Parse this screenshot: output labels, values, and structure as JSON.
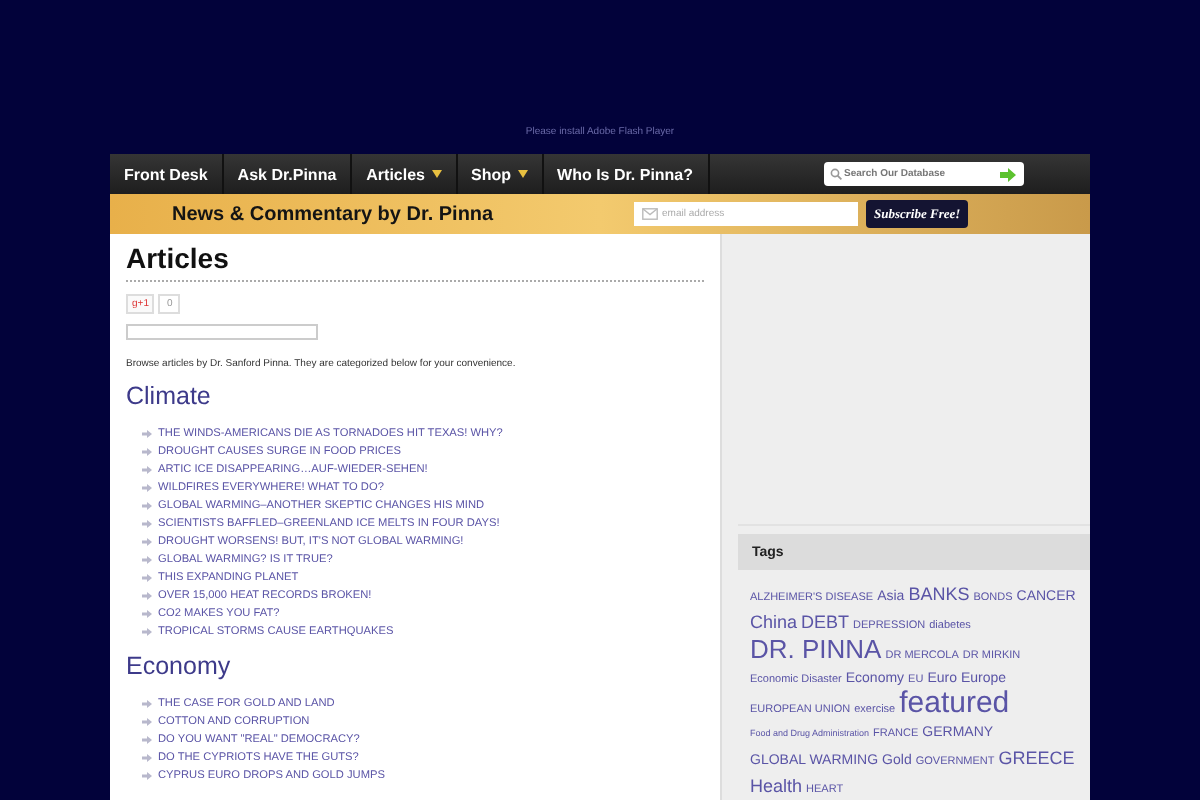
{
  "banner": {
    "text": "Please install Adobe Flash Player"
  },
  "nav": {
    "items": [
      {
        "label": "Front Desk",
        "dropdown": false
      },
      {
        "label": "Ask Dr.Pinna",
        "dropdown": false
      },
      {
        "label": "Articles",
        "dropdown": true
      },
      {
        "label": "Shop",
        "dropdown": true
      },
      {
        "label": "Who Is Dr. Pinna?",
        "dropdown": false
      }
    ],
    "search": {
      "placeholder": "Search Our Database"
    }
  },
  "subheader": {
    "title": "News & Commentary by Dr. Pinna",
    "email": {
      "placeholder": "email address"
    },
    "button": "Subscribe Free!"
  },
  "main": {
    "title": "Articles",
    "gplus": {
      "label": "g+1",
      "count": "0"
    },
    "intro": "Browse articles by Dr. Sanford Pinna. They are categorized below for your convenience.",
    "sections": [
      {
        "heading": "Climate",
        "links": [
          "THE WINDS-AMERICANS DIE AS TORNADOES HIT TEXAS! WHY?",
          "DROUGHT CAUSES SURGE IN FOOD PRICES",
          "ARTIC ICE DISAPPEARING…AUF-WIEDER-SEHEN!",
          "WILDFIRES EVERYWHERE! WHAT TO DO?",
          "GLOBAL WARMING–ANOTHER SKEPTIC CHANGES HIS MIND",
          "SCIENTISTS BAFFLED–GREENLAND ICE MELTS IN FOUR DAYS!",
          "DROUGHT WORSENS! BUT, IT'S NOT GLOBAL WARMING!",
          "GLOBAL WARMING? IS IT TRUE?",
          "THIS EXPANDING PLANET",
          "OVER 15,000 HEAT RECORDS BROKEN!",
          "CO2 MAKES YOU FAT?",
          "TROPICAL STORMS CAUSE EARTHQUAKES"
        ]
      },
      {
        "heading": "Economy",
        "links": [
          "THE CASE FOR GOLD AND LAND",
          "COTTON AND CORRUPTION",
          "DO YOU WANT \"REAL\" DEMOCRACY?",
          "DO THE CYPRIOTS HAVE THE GUTS?",
          "CYPRUS EURO DROPS AND GOLD JUMPS"
        ]
      }
    ]
  },
  "sidebar": {
    "tags_title": "Tags",
    "tags": [
      {
        "label": "ALZHEIMER'S DISEASE",
        "kind": "xs"
      },
      {
        "label": "Asia",
        "kind": "s"
      },
      {
        "label": "BANKS",
        "kind": "m"
      },
      {
        "label": "BONDS",
        "kind": "xs"
      },
      {
        "label": "CANCER",
        "kind": "s"
      },
      {
        "label": "China",
        "kind": "m"
      },
      {
        "label": "DEBT",
        "kind": "m"
      },
      {
        "label": "DEPRESSION",
        "kind": "xs"
      },
      {
        "label": "diabetes",
        "kind": "xs"
      },
      {
        "label": "DR. PINNA",
        "kind": "l"
      },
      {
        "label": "DR MERCOLA",
        "kind": "xs"
      },
      {
        "label": "DR MIRKIN",
        "kind": "xs"
      },
      {
        "label": "Economic Disaster",
        "kind": "xs"
      },
      {
        "label": "Economy",
        "kind": "s"
      },
      {
        "label": "EU",
        "kind": "xs"
      },
      {
        "label": "Euro",
        "kind": "s"
      },
      {
        "label": "Europe",
        "kind": "s"
      },
      {
        "label": "EUROPEAN UNION",
        "kind": "xs"
      },
      {
        "label": "exercise",
        "kind": "xs"
      },
      {
        "label": "featured",
        "kind": "xl"
      },
      {
        "label": "Food and Drug Administration",
        "kind": "xxs"
      },
      {
        "label": "FRANCE",
        "kind": "xs"
      },
      {
        "label": "GERMANY",
        "kind": "s"
      },
      {
        "label": "GLOBAL WARMING",
        "kind": "s"
      },
      {
        "label": "Gold",
        "kind": "s"
      },
      {
        "label": "GOVERNMENT",
        "kind": "xs"
      },
      {
        "label": "GREECE",
        "kind": "m"
      },
      {
        "label": "Health",
        "kind": "m"
      },
      {
        "label": "HEART",
        "kind": "xs"
      }
    ]
  }
}
